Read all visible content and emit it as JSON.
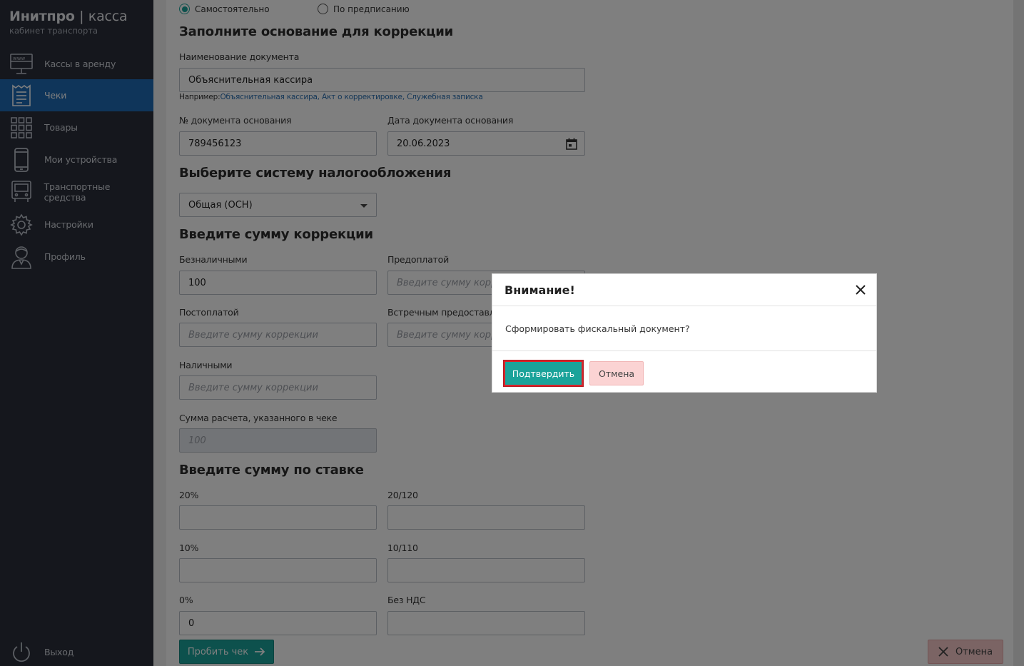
{
  "brand": {
    "name": "Инитпро",
    "separator": "|",
    "product": "касса",
    "subtitle": "кабинет транспорта"
  },
  "sidebar": {
    "items": [
      {
        "label": "Кассы в аренду",
        "icon": "www-monitor-icon",
        "active": false
      },
      {
        "label": "Чеки",
        "icon": "receipt-icon",
        "active": true
      },
      {
        "label": "Товары",
        "icon": "grid-icon",
        "active": false
      },
      {
        "label": "Мои устройства",
        "icon": "phone-icon",
        "active": false
      },
      {
        "label": "Транспортные средства",
        "icon": "bus-icon",
        "active": false
      },
      {
        "label": "Настройки",
        "icon": "gear-icon",
        "active": false
      },
      {
        "label": "Профиль",
        "icon": "user-icon",
        "active": false
      }
    ],
    "logout": "Выход"
  },
  "form": {
    "radio_self": "Самостоятельно",
    "radio_order": "По предписанию",
    "section_basis": "Заполните основание для коррекции",
    "doc_name_label": "Наименование документа",
    "doc_name_value": "Объяснительная кассира",
    "hint_prefix": "Например:",
    "hint_examples": "Объяснительная кассира, Акт о корректировке, Служебная записка",
    "doc_number_label": "№ документа основания",
    "doc_number_value": "789456123",
    "doc_date_label": "Дата документа основания",
    "doc_date_value": "20.06.2023",
    "section_tax": "Выберите систему налогообложения",
    "tax_value": "Общая (ОСН)",
    "section_sum": "Введите сумму коррекции",
    "cashless_label": "Безналичными",
    "cashless_value": "100",
    "prepay_label": "Предоплатой",
    "prepay_placeholder": "Введите сумму коррекции",
    "postpay_label": "Постоплатой",
    "postpay_placeholder": "Введите сумму коррекции",
    "counter_label": "Встречным предоставлением",
    "counter_placeholder": "Введите сумму коррекции",
    "cash_label": "Наличными",
    "cash_placeholder": "Введите сумму коррекции",
    "total_label": "Сумма расчета, указанного в чеке",
    "total_value": "100",
    "section_rate": "Введите сумму по ставке",
    "rate_20_label": "20%",
    "rate_20_120_label": "20/120",
    "rate_10_label": "10%",
    "rate_10_110_label": "10/110",
    "rate_0_label": "0%",
    "rate_0_value": "0",
    "no_vat_label": "Без НДС"
  },
  "footer": {
    "submit_label": "Пробить чек",
    "cancel_label": "Отмена"
  },
  "modal": {
    "title": "Внимание!",
    "message": "Сформировать фискальный документ?",
    "confirm_label": "Подтвердить",
    "cancel_label": "Отмена"
  },
  "colors": {
    "sidebar": "#2b2f3a",
    "active": "#1e6ab4",
    "accent": "#1aa39a",
    "cancel": "#fbd3d3",
    "highlight": "#d9232a"
  }
}
